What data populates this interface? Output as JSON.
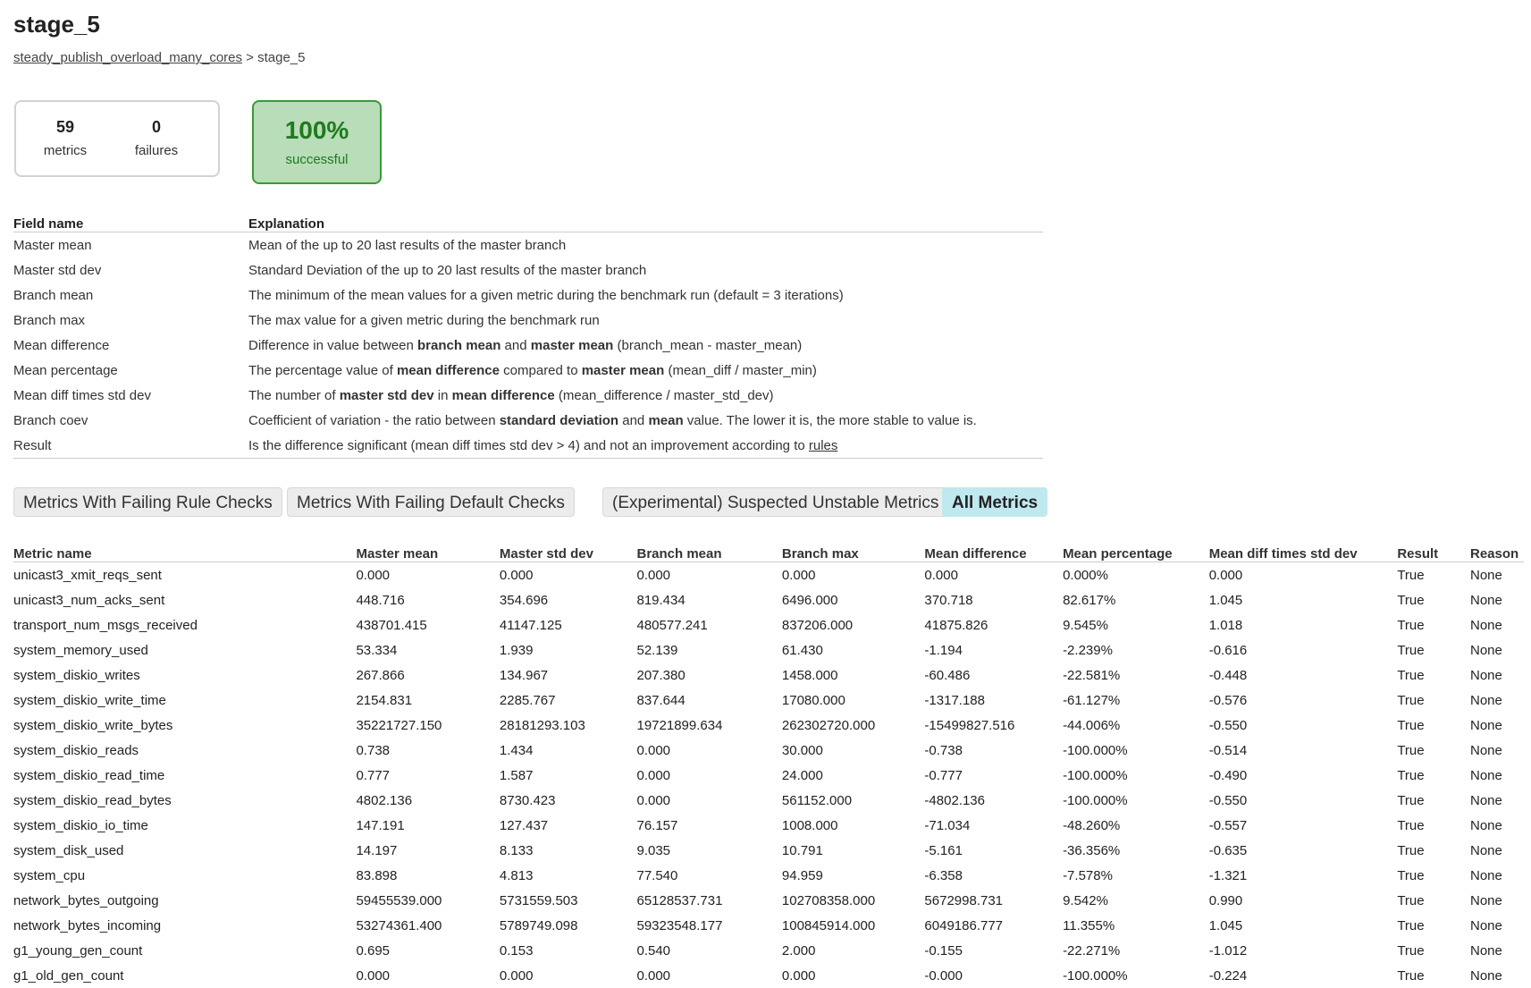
{
  "page": {
    "title": "stage_5",
    "breadcrumb": {
      "parent": "steady_publish_overload_many_cores",
      "separator": ">",
      "current": "stage_5"
    }
  },
  "summary": {
    "metrics_count": "59",
    "metrics_label": "metrics",
    "failures_count": "0",
    "failures_label": "failures",
    "success_pct": "100%",
    "success_label": "successful",
    "colors": {
      "success_bg": "#b8ddb8",
      "success_border": "#3a9a3a",
      "success_text": "#1f7a1f"
    }
  },
  "explanations": {
    "headers": [
      "Field name",
      "Explanation"
    ],
    "rows": [
      {
        "field": "Master mean",
        "parts": [
          {
            "t": "Mean of the up to 20 last results of the master branch"
          }
        ]
      },
      {
        "field": "Master std dev",
        "parts": [
          {
            "t": "Standard Deviation of the up to 20 last results of the master branch"
          }
        ]
      },
      {
        "field": "Branch mean",
        "parts": [
          {
            "t": "The minimum of the mean values for a given metric during the benchmark run (default = 3 iterations)"
          }
        ]
      },
      {
        "field": "Branch max",
        "parts": [
          {
            "t": "The max value for a given metric during the benchmark run"
          }
        ]
      },
      {
        "field": "Mean difference",
        "parts": [
          {
            "t": "Difference in value between "
          },
          {
            "t": "branch mean",
            "b": true
          },
          {
            "t": " and "
          },
          {
            "t": "master mean",
            "b": true
          },
          {
            "t": " (branch_mean - master_mean)"
          }
        ]
      },
      {
        "field": "Mean percentage",
        "parts": [
          {
            "t": "The percentage value of "
          },
          {
            "t": "mean difference",
            "b": true
          },
          {
            "t": " compared to "
          },
          {
            "t": "master mean",
            "b": true
          },
          {
            "t": " (mean_diff / master_min)"
          }
        ]
      },
      {
        "field": "Mean diff times std dev",
        "parts": [
          {
            "t": "The number of "
          },
          {
            "t": "master std dev",
            "b": true
          },
          {
            "t": " in "
          },
          {
            "t": "mean difference",
            "b": true
          },
          {
            "t": " (mean_difference / master_std_dev)"
          }
        ]
      },
      {
        "field": "Branch coev",
        "parts": [
          {
            "t": "Coefficient of variation - the ratio between "
          },
          {
            "t": "standard deviation",
            "b": true
          },
          {
            "t": " and "
          },
          {
            "t": "mean",
            "b": true
          },
          {
            "t": " value. The lower it is, the more stable to value is."
          }
        ]
      },
      {
        "field": "Result",
        "parts": [
          {
            "t": "Is the difference significant (mean diff times std dev > 4) and not an improvement according to "
          },
          {
            "t": "rules",
            "link": true
          }
        ]
      }
    ]
  },
  "tabs": [
    {
      "label": "Metrics With Failing Rule Checks",
      "active": false
    },
    {
      "label": "Metrics With Failing Default Checks",
      "active": false
    },
    {
      "label": "(Experimental) Suspected Unstable Metrics",
      "active": false
    },
    {
      "label": "All Metrics",
      "active": true
    }
  ],
  "metrics": {
    "headers": [
      "Metric name",
      "Master mean",
      "Master std dev",
      "Branch mean",
      "Branch max",
      "Mean difference",
      "Mean percentage",
      "Mean diff times std dev",
      "Result",
      "Reason"
    ],
    "rows": [
      [
        "unicast3_xmit_reqs_sent",
        "0.000",
        "0.000",
        "0.000",
        "0.000",
        "0.000",
        "0.000%",
        "0.000",
        "True",
        "None"
      ],
      [
        "unicast3_num_acks_sent",
        "448.716",
        "354.696",
        "819.434",
        "6496.000",
        "370.718",
        "82.617%",
        "1.045",
        "True",
        "None"
      ],
      [
        "transport_num_msgs_received",
        "438701.415",
        "41147.125",
        "480577.241",
        "837206.000",
        "41875.826",
        "9.545%",
        "1.018",
        "True",
        "None"
      ],
      [
        "system_memory_used",
        "53.334",
        "1.939",
        "52.139",
        "61.430",
        "-1.194",
        "-2.239%",
        "-0.616",
        "True",
        "None"
      ],
      [
        "system_diskio_writes",
        "267.866",
        "134.967",
        "207.380",
        "1458.000",
        "-60.486",
        "-22.581%",
        "-0.448",
        "True",
        "None"
      ],
      [
        "system_diskio_write_time",
        "2154.831",
        "2285.767",
        "837.644",
        "17080.000",
        "-1317.188",
        "-61.127%",
        "-0.576",
        "True",
        "None"
      ],
      [
        "system_diskio_write_bytes",
        "35221727.150",
        "28181293.103",
        "19721899.634",
        "262302720.000",
        "-15499827.516",
        "-44.006%",
        "-0.550",
        "True",
        "None"
      ],
      [
        "system_diskio_reads",
        "0.738",
        "1.434",
        "0.000",
        "30.000",
        "-0.738",
        "-100.000%",
        "-0.514",
        "True",
        "None"
      ],
      [
        "system_diskio_read_time",
        "0.777",
        "1.587",
        "0.000",
        "24.000",
        "-0.777",
        "-100.000%",
        "-0.490",
        "True",
        "None"
      ],
      [
        "system_diskio_read_bytes",
        "4802.136",
        "8730.423",
        "0.000",
        "561152.000",
        "-4802.136",
        "-100.000%",
        "-0.550",
        "True",
        "None"
      ],
      [
        "system_diskio_io_time",
        "147.191",
        "127.437",
        "76.157",
        "1008.000",
        "-71.034",
        "-48.260%",
        "-0.557",
        "True",
        "None"
      ],
      [
        "system_disk_used",
        "14.197",
        "8.133",
        "9.035",
        "10.791",
        "-5.161",
        "-36.356%",
        "-0.635",
        "True",
        "None"
      ],
      [
        "system_cpu",
        "83.898",
        "4.813",
        "77.540",
        "94.959",
        "-6.358",
        "-7.578%",
        "-1.321",
        "True",
        "None"
      ],
      [
        "network_bytes_outgoing",
        "59455539.000",
        "5731559.503",
        "65128537.731",
        "102708358.000",
        "5672998.731",
        "9.542%",
        "0.990",
        "True",
        "None"
      ],
      [
        "network_bytes_incoming",
        "53274361.400",
        "5789749.098",
        "59323548.177",
        "100845914.000",
        "6049186.777",
        "11.355%",
        "1.045",
        "True",
        "None"
      ],
      [
        "g1_young_gen_count",
        "0.695",
        "0.153",
        "0.540",
        "2.000",
        "-0.155",
        "-22.271%",
        "-1.012",
        "True",
        "None"
      ],
      [
        "g1_old_gen_count",
        "0.000",
        "0.000",
        "0.000",
        "0.000",
        "-0.000",
        "-100.000%",
        "-0.224",
        "True",
        "None"
      ]
    ]
  }
}
